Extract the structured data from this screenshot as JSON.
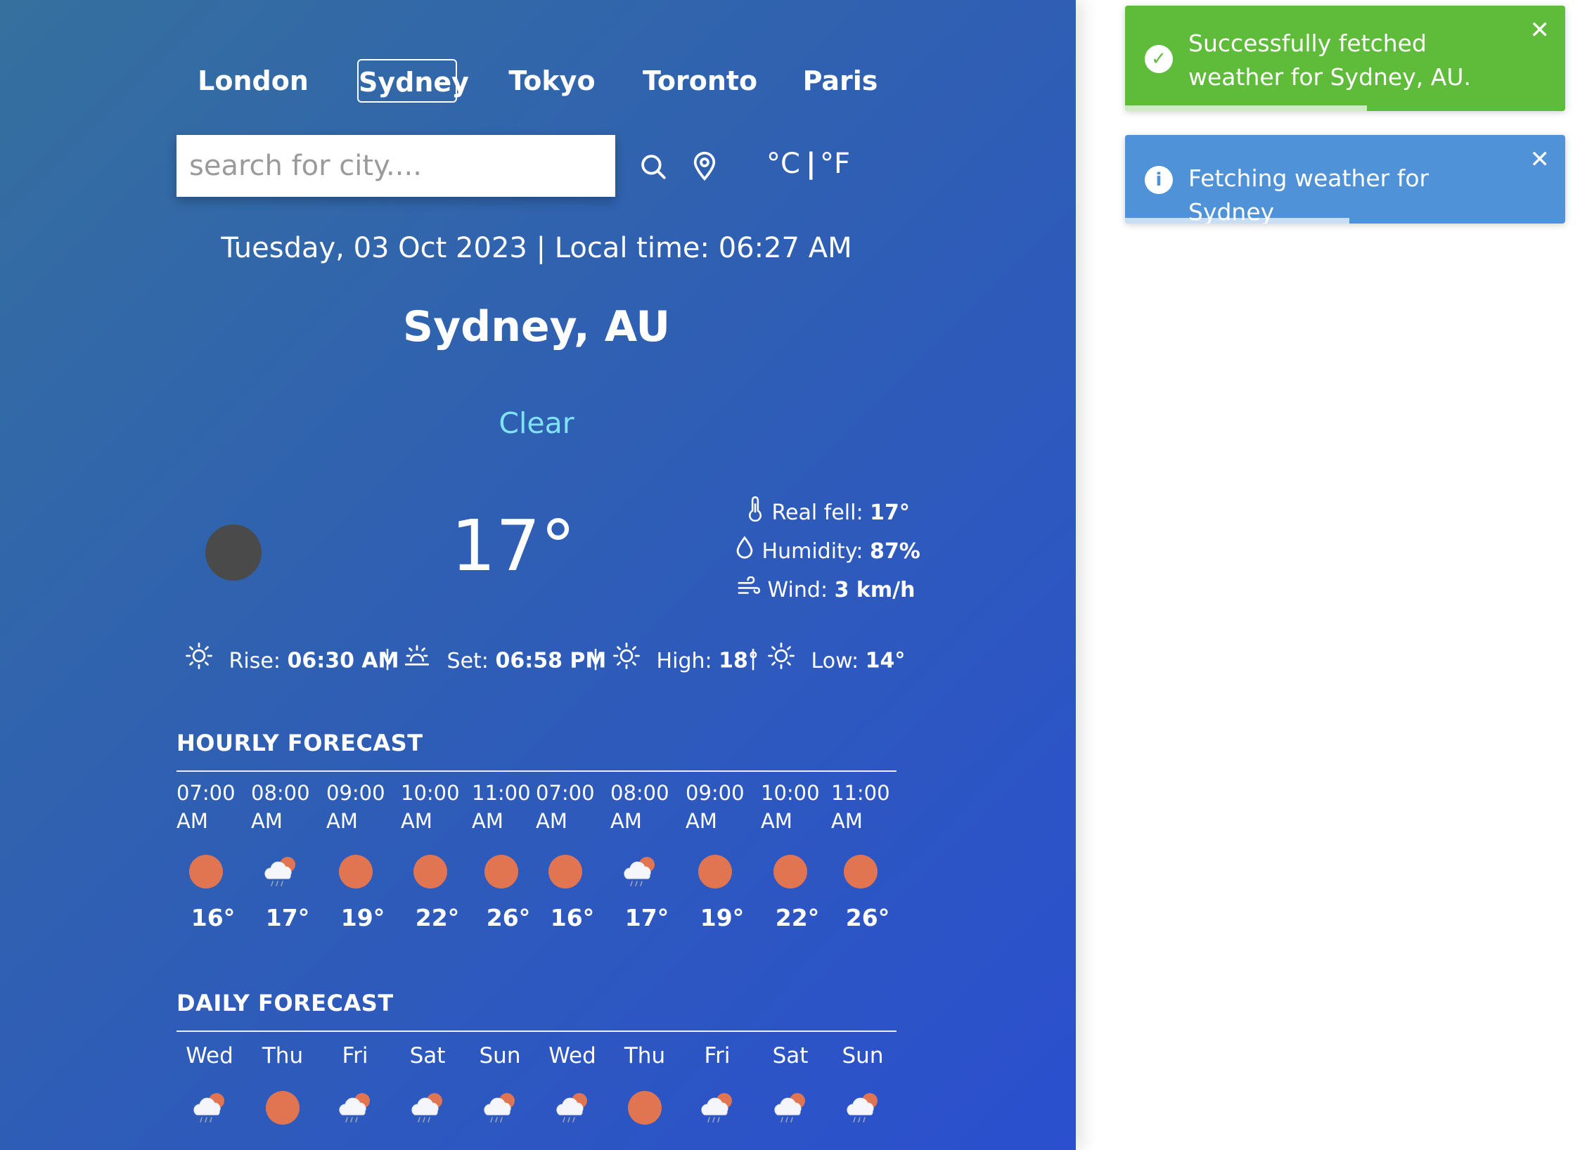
{
  "nav": {
    "cities": [
      "London",
      "Sydney",
      "Tokyo",
      "Toronto",
      "Paris"
    ],
    "active": "Sydney"
  },
  "search": {
    "placeholder": "search for city...."
  },
  "units": {
    "celsius": "°C",
    "separator": "|",
    "fahrenheit": "°F"
  },
  "header": {
    "datetime": "Tuesday, 03 Oct 2023 | Local time: 06:27 AM",
    "location": "Sydney, AU",
    "condition": "Clear"
  },
  "current": {
    "temp": "17°",
    "details": [
      {
        "icon": "thermometer-icon",
        "label": "Real fell: ",
        "value": "17°"
      },
      {
        "icon": "droplet-icon",
        "label": "Humidity: ",
        "value": "87%"
      },
      {
        "icon": "wind-icon",
        "label": "Wind: ",
        "value": "3 km/h"
      }
    ],
    "sun": [
      {
        "icon": "sunrise-icon",
        "label": "Rise: ",
        "value": "06:30 AM"
      },
      {
        "icon": "sunset-icon",
        "label": "Set: ",
        "value": "06:58 PM"
      },
      {
        "icon": "sun-icon",
        "label": "High: ",
        "value": "18°"
      },
      {
        "icon": "sun-icon",
        "label": "Low: ",
        "value": "14°"
      }
    ],
    "sep": "|"
  },
  "hourly": {
    "title": "HOURLY FORECAST",
    "items": [
      {
        "time": "07:00",
        "ampm": "AM",
        "icon": "sun-icon",
        "temp": "16°"
      },
      {
        "time": "08:00",
        "ampm": "AM",
        "icon": "cloud-rain-sun-icon",
        "temp": "17°"
      },
      {
        "time": "09:00",
        "ampm": "AM",
        "icon": "sun-icon",
        "temp": "19°"
      },
      {
        "time": "10:00",
        "ampm": "AM",
        "icon": "sun-icon",
        "temp": "22°"
      },
      {
        "time": "11:00",
        "ampm": "AM",
        "icon": "sun-icon",
        "temp": "26°"
      },
      {
        "time": "07:00",
        "ampm": "AM",
        "icon": "sun-icon",
        "temp": "16°"
      },
      {
        "time": "08:00",
        "ampm": "AM",
        "icon": "cloud-rain-sun-icon",
        "temp": "17°"
      },
      {
        "time": "09:00",
        "ampm": "AM",
        "icon": "sun-icon",
        "temp": "19°"
      },
      {
        "time": "10:00",
        "ampm": "AM",
        "icon": "sun-icon",
        "temp": "22°"
      },
      {
        "time": "11:00",
        "ampm": "AM",
        "icon": "sun-icon",
        "temp": "26°"
      }
    ]
  },
  "daily": {
    "title": "DAILY FORECAST",
    "items": [
      {
        "day": "Wed",
        "icon": "cloud-rain-sun-icon"
      },
      {
        "day": "Thu",
        "icon": "sun-icon"
      },
      {
        "day": "Fri",
        "icon": "cloud-rain-sun-icon"
      },
      {
        "day": "Sat",
        "icon": "cloud-rain-sun-icon"
      },
      {
        "day": "Sun",
        "icon": "cloud-rain-sun-icon"
      },
      {
        "day": "Wed",
        "icon": "cloud-rain-sun-icon"
      },
      {
        "day": "Thu",
        "icon": "sun-icon"
      },
      {
        "day": "Fri",
        "icon": "cloud-rain-sun-icon"
      },
      {
        "day": "Sat",
        "icon": "cloud-rain-sun-icon"
      },
      {
        "day": "Sun",
        "icon": "cloud-rain-sun-icon"
      }
    ]
  },
  "toasts": [
    {
      "type": "success",
      "icon": "check-circle-icon",
      "text": "Successfully fetched weather for Sydney, AU.",
      "progress": 0.55,
      "color": "#5fbb3a"
    },
    {
      "type": "info",
      "icon": "info-circle-icon",
      "text": "Fetching weather for Sydney",
      "progress": 0.51,
      "color": "#4f92d8"
    }
  ],
  "colors": {
    "accent_condition": "#7fe3f5",
    "sun": "#e17552",
    "moon_dark": "#4a4a4a"
  }
}
